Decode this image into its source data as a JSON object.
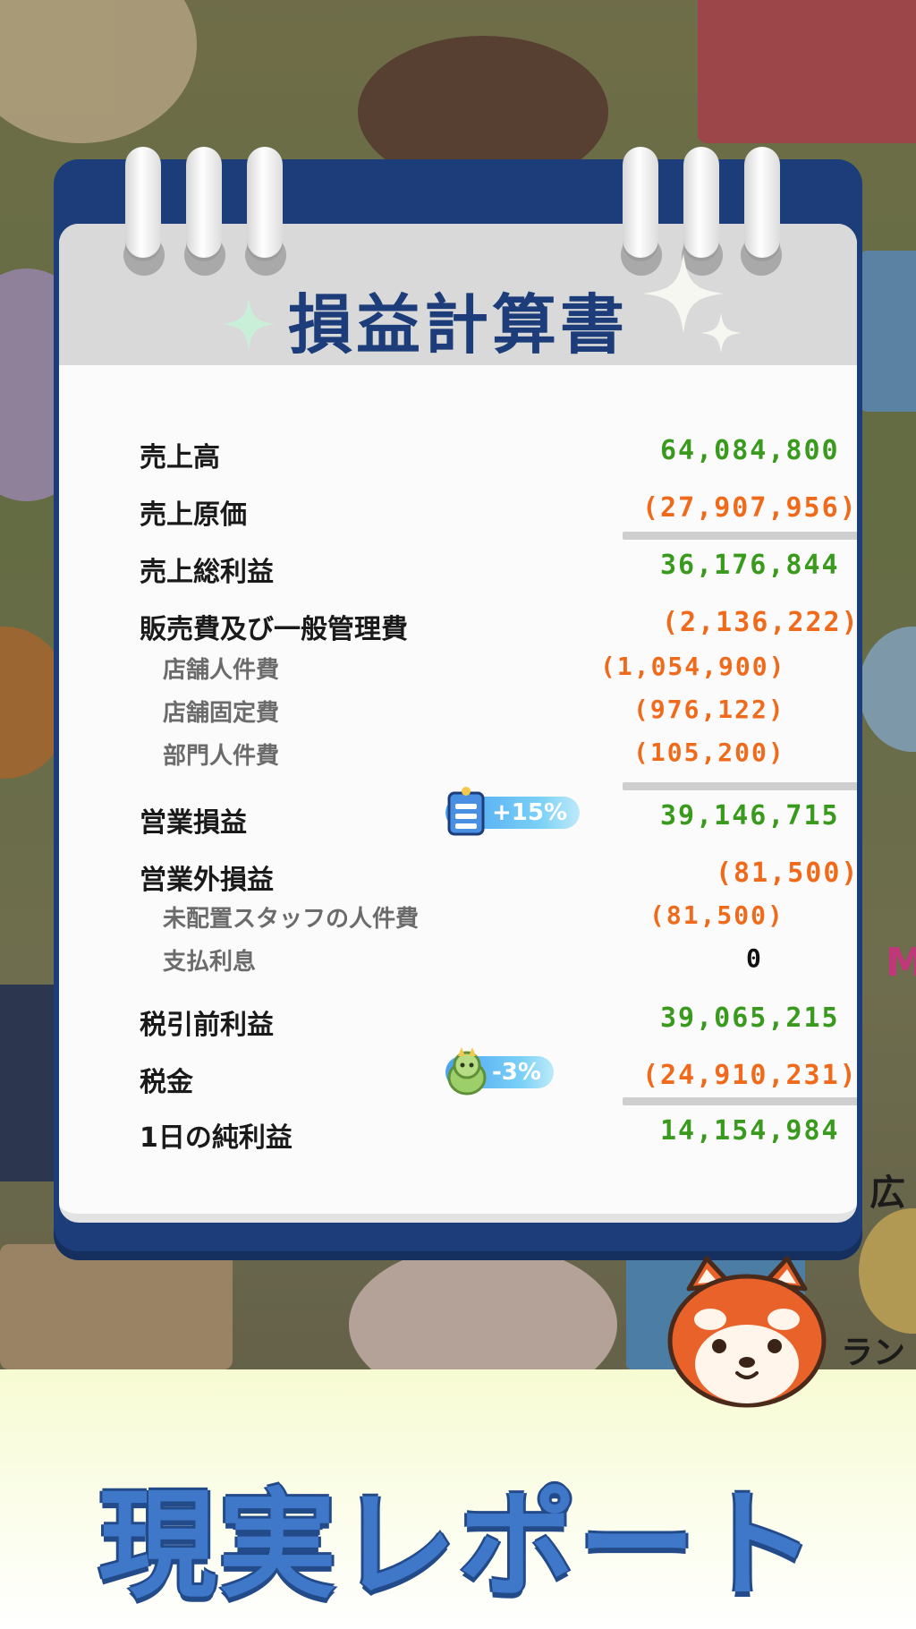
{
  "sheet": {
    "title": "損益計算書",
    "rows": [
      {
        "label": "売上高",
        "value": "64,084,800"
      },
      {
        "label": "売上原価",
        "value": "(27,907,956)"
      },
      {
        "label": "売上総利益",
        "value": "36,176,844"
      },
      {
        "label": "販売費及び一般管理費",
        "value": "(2,136,222)"
      },
      {
        "label": "店舗人件費",
        "value": "(1,054,900)"
      },
      {
        "label": "店舗固定費",
        "value": "(976,122)"
      },
      {
        "label": "部門人件費",
        "value": "(105,200)"
      },
      {
        "label": "営業損益",
        "value": "39,146,715",
        "badge": "+15%"
      },
      {
        "label": "営業外損益",
        "value": "(81,500)"
      },
      {
        "label": "未配置スタッフの人件費",
        "value": "(81,500)"
      },
      {
        "label": "支払利息",
        "value": "0"
      },
      {
        "label": "税引前利益",
        "value": "39,065,215"
      },
      {
        "label": "税金",
        "value": "(24,910,231)",
        "badge": "-3%"
      },
      {
        "label": "1日の純利益",
        "value": "14,154,984"
      }
    ]
  },
  "background": {
    "side_text_1": "広",
    "side_text_2": "ランキ",
    "side_text_3": "M"
  },
  "banner": {
    "title": "現実レポート"
  },
  "colors": {
    "positive": "#3a9a1e",
    "negative": "#f06a1c",
    "navy": "#1c3d7a",
    "banner_text": "#3f78c9"
  }
}
